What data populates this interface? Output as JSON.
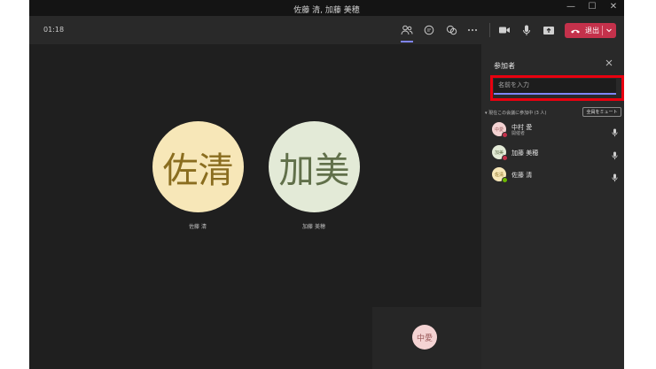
{
  "window": {
    "title": "佐藤 清, 加藤 美穂",
    "controls": [
      "—",
      "☐",
      "✕"
    ]
  },
  "toolbar": {
    "timer": "01:18",
    "icons": [
      "people-icon",
      "chat-icon",
      "reactions-icon",
      "more-icon",
      "camera-icon",
      "mic-icon",
      "share-icon"
    ],
    "leave_label": "退出"
  },
  "stage": {
    "tiles": [
      {
        "initials": "佐清",
        "name": "佐藤 清",
        "bg": "#f7e7b8",
        "fg": "#8a6d1f"
      },
      {
        "initials": "加美",
        "name": "加藤 美穂",
        "bg": "#e3ead7",
        "fg": "#61704a"
      }
    ],
    "self": {
      "initials": "中愛"
    }
  },
  "panel": {
    "title": "参加者",
    "search_placeholder": "名前を入力",
    "section_label": "▾ 現在この会議に参加中 (3 人)",
    "mute_all_label": "全員をミュート",
    "participants": [
      {
        "initials": "中愛",
        "name": "中村 愛",
        "role": "開催者",
        "bg": "#f4d3d3",
        "fg": "#9a5a5a",
        "status": "#c4314b"
      },
      {
        "initials": "加美",
        "name": "加藤 美穂",
        "role": "",
        "bg": "#e3ead7",
        "fg": "#61704a",
        "status": "#c4314b"
      },
      {
        "initials": "佐清",
        "name": "佐藤 清",
        "role": "",
        "bg": "#f7e7b8",
        "fg": "#8a6d1f",
        "status": "#6bb700"
      }
    ]
  },
  "colors": {
    "accent": "#7f85f5",
    "leave": "#c4314b",
    "highlight": "#e8000f"
  }
}
